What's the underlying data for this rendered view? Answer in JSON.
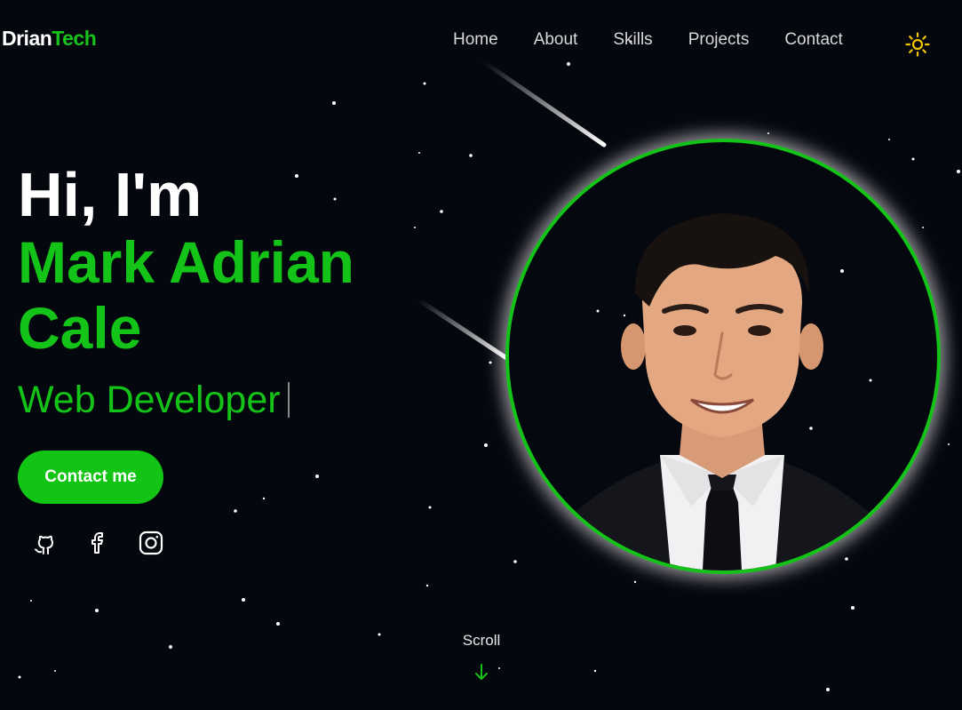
{
  "brand": {
    "part1": "Drian",
    "part2": "Tech"
  },
  "nav": {
    "items": [
      {
        "label": "Home"
      },
      {
        "label": "About"
      },
      {
        "label": "Skills"
      },
      {
        "label": "Projects"
      },
      {
        "label": "Contact"
      }
    ],
    "theme_icon": "sun-icon"
  },
  "hero": {
    "greeting": "Hi, I'm",
    "name": "Mark Adrian Cale",
    "role": "Web Developer",
    "cta_label": "Contact me"
  },
  "social": [
    {
      "icon": "github-icon"
    },
    {
      "icon": "facebook-icon"
    },
    {
      "icon": "instagram-icon"
    }
  ],
  "scroll": {
    "label": "Scroll",
    "icon": "arrow-down-icon"
  },
  "colors": {
    "accent": "#14c317",
    "background": "#05070f",
    "sun": "#f2c400"
  }
}
